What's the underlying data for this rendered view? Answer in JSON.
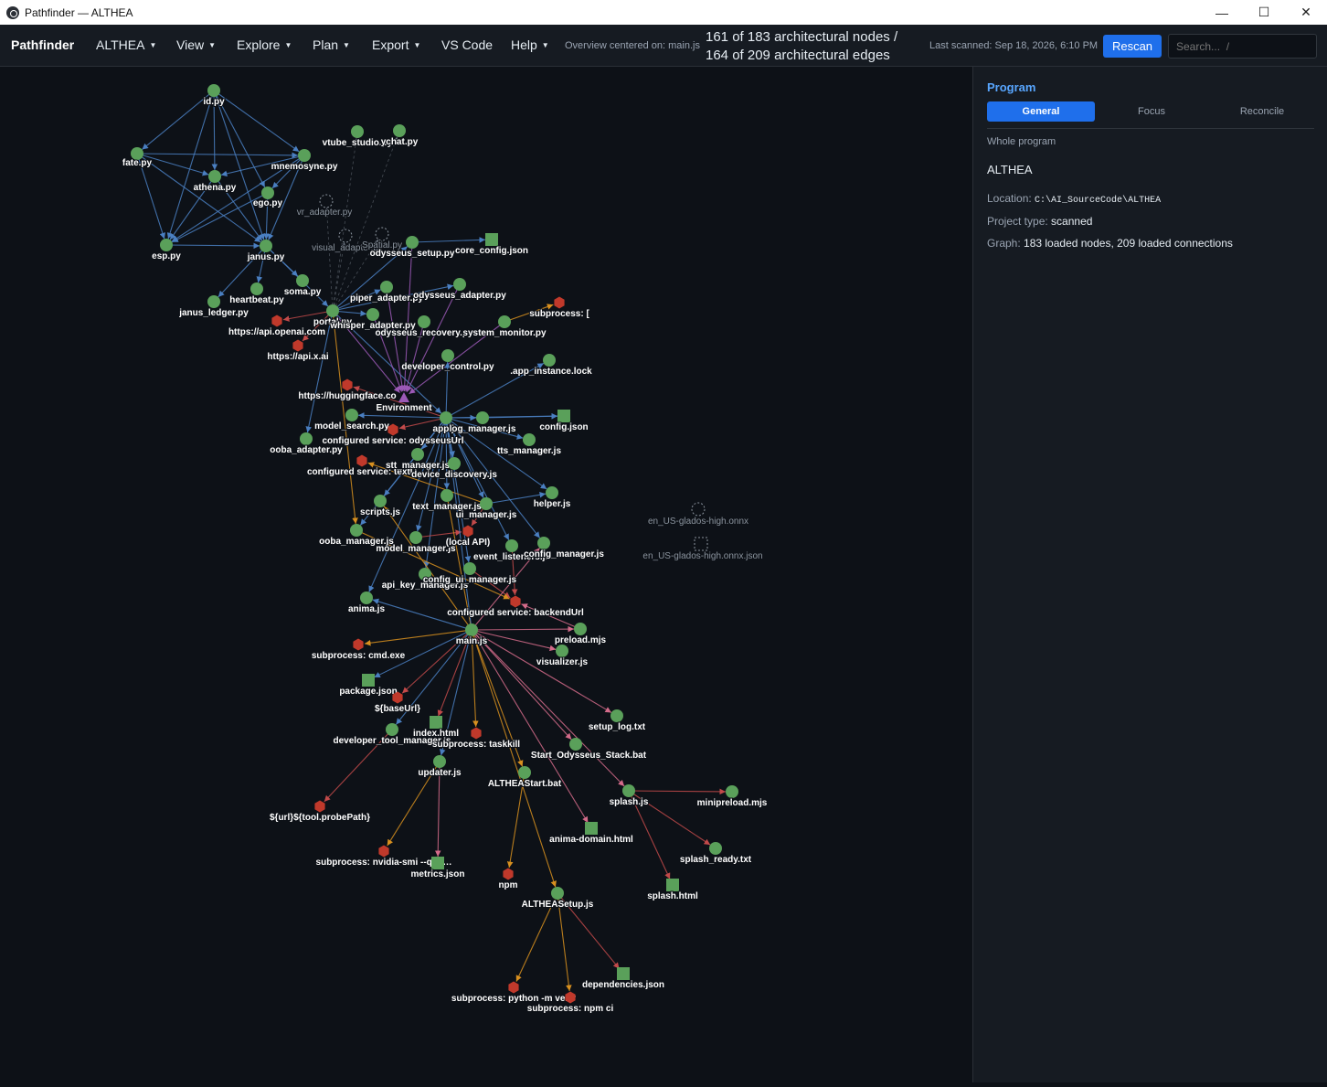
{
  "window": {
    "title": "Pathfinder — ALTHEA",
    "minimize_icon": "minimize-icon",
    "maximize_icon": "maximize-icon",
    "close_icon": "close-icon"
  },
  "menubar": {
    "brand": "Pathfinder",
    "items": [
      "ALTHEA",
      "View",
      "Explore",
      "Plan",
      "Export",
      "VS Code",
      "Help"
    ],
    "overview": "Overview centered on: main.js",
    "counts_line1": "161 of 183 architectural nodes /",
    "counts_line2": "164 of 209 architectural edges",
    "last_scanned": "Last scanned: Sep 18, 2026, 6:10 PM",
    "rescan": "Rescan",
    "search_placeholder": "Search...  /"
  },
  "panel": {
    "title": "Program",
    "tabs": [
      "General",
      "Focus",
      "Reconcile"
    ],
    "active_tab": "General",
    "section": "Whole program",
    "program_name": "ALTHEA",
    "location_label": "Location:",
    "location": "C:\\AI_SourceCode\\ALTHEA",
    "project_type_label": "Project type:",
    "project_type": "scanned",
    "graph_label": "Graph:",
    "graph_summary": "183 loaded nodes, 209 loaded connections"
  },
  "graph": {
    "colors": {
      "background": "#0d1117",
      "file_node": "#5aa05a",
      "config_node": "#5aa05a",
      "external_node": "#c0392b",
      "hub_node": "#9b59b6",
      "edge_blue": "#4a7fc1",
      "edge_orange": "#d8901f",
      "edge_red": "#c24a4a",
      "edge_purple": "#9b59b6",
      "edge_pink": "#d46b8a",
      "edge_dashed": "#6e7681"
    },
    "nodes": [
      {
        "id": "id",
        "label": "id.py",
        "shape": "circle"
      },
      {
        "id": "fate",
        "label": "fate.py",
        "shape": "circle"
      },
      {
        "id": "mnemosyne",
        "label": "mnemosyne.py",
        "shape": "circle"
      },
      {
        "id": "athena",
        "label": "athena.py",
        "shape": "circle"
      },
      {
        "id": "ego",
        "label": "ego.py",
        "shape": "circle"
      },
      {
        "id": "esp",
        "label": "esp.py",
        "shape": "circle"
      },
      {
        "id": "janus",
        "label": "janus.py",
        "shape": "circle"
      },
      {
        "id": "vtube",
        "label": "vtube_studio.py",
        "shape": "circle"
      },
      {
        "id": "ychat",
        "label": "ychat.py",
        "shape": "circle"
      },
      {
        "id": "vr_adapter",
        "label": "vr_adapter.py",
        "shape": "dashed"
      },
      {
        "id": "visual_adapter",
        "label": "visual_adapter.py",
        "shape": "dashed"
      },
      {
        "id": "spatial",
        "label": "Spatial.py",
        "shape": "dashed"
      },
      {
        "id": "odysseus_setup",
        "label": "odysseus_setup.py",
        "shape": "circle"
      },
      {
        "id": "core_config",
        "label": "core_config.json",
        "shape": "square"
      },
      {
        "id": "soma",
        "label": "soma.py",
        "shape": "circle"
      },
      {
        "id": "heartbeat",
        "label": "heartbeat.py",
        "shape": "circle"
      },
      {
        "id": "janus_ledger",
        "label": "janus_ledger.py",
        "shape": "circle"
      },
      {
        "id": "piper",
        "label": "piper_adapter.py",
        "shape": "circle"
      },
      {
        "id": "odysseus_adapter",
        "label": "odysseus_adapter.py",
        "shape": "circle"
      },
      {
        "id": "portal",
        "label": "portal.py",
        "shape": "circle"
      },
      {
        "id": "whisper",
        "label": "whisper_adapter.py",
        "shape": "circle"
      },
      {
        "id": "odysseus_recovery",
        "label": "odysseus_recovery.py",
        "shape": "circle"
      },
      {
        "id": "system_monitor",
        "label": "system_monitor.py",
        "shape": "circle"
      },
      {
        "id": "subprocess_bracket",
        "label": "subprocess: [",
        "shape": "hexagon"
      },
      {
        "id": "openai",
        "label": "https://api.openai.com",
        "shape": "hexagon"
      },
      {
        "id": "xai",
        "label": "https://api.x.ai",
        "shape": "hexagon"
      },
      {
        "id": "developer_control",
        "label": "developer_control.py",
        "shape": "circle"
      },
      {
        "id": "app_instance",
        "label": ".app_instance.lock",
        "shape": "circle"
      },
      {
        "id": "huggingface",
        "label": "https://huggingface.co",
        "shape": "hexagon"
      },
      {
        "id": "environment",
        "label": "Environment",
        "shape": "triangle"
      },
      {
        "id": "model_search",
        "label": "model_search.py",
        "shape": "circle"
      },
      {
        "id": "app_js",
        "label": "app.js",
        "shape": "circle"
      },
      {
        "id": "log_manager",
        "label": "log_manager.js",
        "shape": "circle"
      },
      {
        "id": "config_json",
        "label": "config.json",
        "shape": "square"
      },
      {
        "id": "svc_odysseus",
        "label": "configured service: odysseusUrl",
        "shape": "hexagon"
      },
      {
        "id": "ooba_adapter",
        "label": "ooba_adapter.py",
        "shape": "circle"
      },
      {
        "id": "tts_manager",
        "label": "tts_manager.js",
        "shape": "circle"
      },
      {
        "id": "svc_textu",
        "label": "configured service: textU",
        "shape": "hexagon"
      },
      {
        "id": "stt_manager",
        "label": "stt_manager.js",
        "shape": "circle"
      },
      {
        "id": "device_discovery",
        "label": "device_discovery.js",
        "shape": "circle"
      },
      {
        "id": "scripts_js",
        "label": "scripts.js",
        "shape": "circle"
      },
      {
        "id": "text_manager",
        "label": "text_manager.js",
        "shape": "circle"
      },
      {
        "id": "ui_manager",
        "label": "ui_manager.js",
        "shape": "circle"
      },
      {
        "id": "helper",
        "label": "helper.js",
        "shape": "circle"
      },
      {
        "id": "ooba_manager",
        "label": "ooba_manager.js",
        "shape": "circle"
      },
      {
        "id": "model_manager",
        "label": "model_manager.js",
        "shape": "circle"
      },
      {
        "id": "local_api",
        "label": "(local API)",
        "shape": "hexagon"
      },
      {
        "id": "event_listeners",
        "label": "event_listeners.js",
        "shape": "circle"
      },
      {
        "id": "config_manager",
        "label": "config_manager.js",
        "shape": "circle"
      },
      {
        "id": "api_key_manager",
        "label": "api_key_manager.js",
        "shape": "circle"
      },
      {
        "id": "config_ui_manager",
        "label": "config_ui_manager.js",
        "shape": "circle"
      },
      {
        "id": "anima_js",
        "label": "anima.js",
        "shape": "circle"
      },
      {
        "id": "svc_backend",
        "label": "configured service: backendUrl",
        "shape": "hexagon"
      },
      {
        "id": "main_js",
        "label": "main.js",
        "shape": "circle"
      },
      {
        "id": "preload",
        "label": "preload.mjs",
        "shape": "circle"
      },
      {
        "id": "visualizer",
        "label": "visualizer.js",
        "shape": "circle"
      },
      {
        "id": "sub_cmd",
        "label": "subprocess: cmd.exe",
        "shape": "hexagon"
      },
      {
        "id": "package_json",
        "label": "package.json",
        "shape": "square"
      },
      {
        "id": "base_url",
        "label": "${baseUrl}",
        "shape": "hexagon"
      },
      {
        "id": "setup_log",
        "label": "setup_log.txt",
        "shape": "circle"
      },
      {
        "id": "developer_tool",
        "label": "developer_tool_manager.js",
        "shape": "circle"
      },
      {
        "id": "index_html",
        "label": "index.html",
        "shape": "square"
      },
      {
        "id": "sub_taskkill",
        "label": "subprocess: taskkill",
        "shape": "hexagon"
      },
      {
        "id": "start_odysseus",
        "label": "Start_Odysseus_Stack.bat",
        "shape": "circle"
      },
      {
        "id": "updater",
        "label": "updater.js",
        "shape": "circle"
      },
      {
        "id": "althea_start",
        "label": "ALTHEAStart.bat",
        "shape": "circle"
      },
      {
        "id": "splash_js",
        "label": "splash.js",
        "shape": "circle"
      },
      {
        "id": "minipreload",
        "label": "minipreload.mjs",
        "shape": "circle"
      },
      {
        "id": "url_probe",
        "label": "${url}${tool.probePath}",
        "shape": "hexagon"
      },
      {
        "id": "anima_domain",
        "label": "anima-domain.html",
        "shape": "square"
      },
      {
        "id": "splash_ready",
        "label": "splash_ready.txt",
        "shape": "circle"
      },
      {
        "id": "sub_nvidia",
        "label": "subprocess: nvidia-smi --que…",
        "shape": "hexagon"
      },
      {
        "id": "metrics",
        "label": "metrics.json",
        "shape": "square"
      },
      {
        "id": "npm",
        "label": "npm",
        "shape": "hexagon"
      },
      {
        "id": "splash_html",
        "label": "splash.html",
        "shape": "square"
      },
      {
        "id": "althea_setup",
        "label": "ALTHEASetup.js",
        "shape": "circle"
      },
      {
        "id": "dependencies",
        "label": "dependencies.json",
        "shape": "square"
      },
      {
        "id": "sub_python",
        "label": "subprocess: python -m venv",
        "shape": "hexagon"
      },
      {
        "id": "sub_npmci",
        "label": "subprocess: npm ci",
        "shape": "hexagon"
      },
      {
        "id": "glados_onnx",
        "label": "en_US-glados-high.onnx",
        "shape": "dashed"
      },
      {
        "id": "glados_json",
        "label": "en_US-glados-high.onnx.json",
        "shape": "dashed-square"
      }
    ],
    "edges": [
      [
        "id",
        "fate",
        "blue"
      ],
      [
        "id",
        "mnemosyne",
        "blue"
      ],
      [
        "id",
        "athena",
        "blue"
      ],
      [
        "id",
        "esp",
        "blue"
      ],
      [
        "id",
        "janus",
        "blue"
      ],
      [
        "id",
        "ego",
        "blue"
      ],
      [
        "fate",
        "mnemosyne",
        "blue"
      ],
      [
        "fate",
        "athena",
        "blue"
      ],
      [
        "fate",
        "esp",
        "blue"
      ],
      [
        "fate",
        "janus",
        "blue"
      ],
      [
        "mnemosyne",
        "athena",
        "blue"
      ],
      [
        "mnemosyne",
        "esp",
        "blue"
      ],
      [
        "mnemosyne",
        "janus",
        "blue"
      ],
      [
        "mnemosyne",
        "ego",
        "blue"
      ],
      [
        "athena",
        "esp",
        "blue"
      ],
      [
        "athena",
        "janus",
        "blue"
      ],
      [
        "ego",
        "esp",
        "blue"
      ],
      [
        "ego",
        "janus",
        "blue"
      ],
      [
        "esp",
        "janus",
        "blue"
      ],
      [
        "janus",
        "soma",
        "blue"
      ],
      [
        "janus",
        "portal",
        "blue"
      ],
      [
        "janus",
        "heartbeat",
        "blue"
      ],
      [
        "janus",
        "janus_ledger",
        "blue"
      ],
      [
        "portal",
        "openai",
        "red"
      ],
      [
        "portal",
        "xai",
        "red"
      ],
      [
        "portal",
        "vr_adapter",
        "dashed"
      ],
      [
        "portal",
        "visual_adapter",
        "dashed"
      ],
      [
        "portal",
        "vtube",
        "dashed"
      ],
      [
        "portal",
        "ychat",
        "dashed"
      ],
      [
        "portal",
        "spatial",
        "dashed"
      ],
      [
        "portal",
        "piper",
        "blue"
      ],
      [
        "portal",
        "odysseus_adapter",
        "blue"
      ],
      [
        "portal",
        "whisper",
        "blue"
      ],
      [
        "portal",
        "odysseus_setup",
        "blue"
      ],
      [
        "portal",
        "environment",
        "purple"
      ],
      [
        "portal",
        "app_js",
        "blue"
      ],
      [
        "portal",
        "ooba_adapter",
        "blue"
      ],
      [
        "portal",
        "ooba_manager",
        "orange"
      ],
      [
        "odysseus_setup",
        "core_config",
        "blue"
      ],
      [
        "odysseus_setup",
        "environment",
        "purple"
      ],
      [
        "odysseus_adapter",
        "environment",
        "purple"
      ],
      [
        "odysseus_recovery",
        "environment",
        "purple"
      ],
      [
        "system_monitor",
        "subprocess_bracket",
        "orange"
      ],
      [
        "system_monitor",
        "environment",
        "purple"
      ],
      [
        "piper",
        "environment",
        "purple"
      ],
      [
        "whisper",
        "environment",
        "purple"
      ],
      [
        "app_js",
        "developer_control",
        "blue"
      ],
      [
        "app_js",
        "app_instance",
        "blue"
      ],
      [
        "app_js",
        "config_json",
        "blue"
      ],
      [
        "app_js",
        "log_manager",
        "blue"
      ],
      [
        "app_js",
        "huggingface",
        "red"
      ],
      [
        "app_js",
        "model_search",
        "blue"
      ],
      [
        "app_js",
        "svc_odysseus",
        "red"
      ],
      [
        "app_js",
        "tts_manager",
        "blue"
      ],
      [
        "app_js",
        "stt_manager",
        "blue"
      ],
      [
        "app_js",
        "device_discovery",
        "blue"
      ],
      [
        "app_js",
        "scripts_js",
        "blue"
      ],
      [
        "app_js",
        "text_manager",
        "blue"
      ],
      [
        "app_js",
        "ui_manager",
        "blue"
      ],
      [
        "app_js",
        "ooba_manager",
        "blue"
      ],
      [
        "app_js",
        "model_manager",
        "blue"
      ],
      [
        "app_js",
        "event_listeners",
        "blue"
      ],
      [
        "app_js",
        "config_manager",
        "blue"
      ],
      [
        "app_js",
        "api_key_manager",
        "blue"
      ],
      [
        "app_js",
        "anima_js",
        "blue"
      ],
      [
        "app_js",
        "helper",
        "blue"
      ],
      [
        "app_js",
        "config_ui_manager",
        "blue"
      ],
      [
        "log_manager",
        "config_json",
        "blue"
      ],
      [
        "ui_manager",
        "local_api",
        "red"
      ],
      [
        "ui_manager",
        "svc_textu",
        "orange"
      ],
      [
        "ui_manager",
        "helper",
        "blue"
      ],
      [
        "model_manager",
        "local_api",
        "red"
      ],
      [
        "event_listeners",
        "svc_backend",
        "red"
      ],
      [
        "config_ui_manager",
        "svc_backend",
        "red"
      ],
      [
        "ooba_manager",
        "svc_backend",
        "orange"
      ],
      [
        "main_js",
        "preload",
        "pink"
      ],
      [
        "main_js",
        "visualizer",
        "pink"
      ],
      [
        "main_js",
        "sub_cmd",
        "orange"
      ],
      [
        "main_js",
        "package_json",
        "blue"
      ],
      [
        "main_js",
        "base_url",
        "red"
      ],
      [
        "main_js",
        "setup_log",
        "pink"
      ],
      [
        "main_js",
        "developer_tool",
        "blue"
      ],
      [
        "main_js",
        "index_html",
        "red"
      ],
      [
        "main_js",
        "sub_taskkill",
        "orange"
      ],
      [
        "main_js",
        "start_odysseus",
        "pink"
      ],
      [
        "main_js",
        "updater",
        "blue"
      ],
      [
        "main_js",
        "althea_start",
        "orange"
      ],
      [
        "main_js",
        "splash_js",
        "pink"
      ],
      [
        "main_js",
        "anima_domain",
        "pink"
      ],
      [
        "main_js",
        "althea_setup",
        "orange"
      ],
      [
        "main_js",
        "config_manager",
        "pink"
      ],
      [
        "main_js",
        "text_manager",
        "orange"
      ],
      [
        "main_js",
        "scripts_js",
        "orange"
      ],
      [
        "main_js",
        "anima_js",
        "blue"
      ],
      [
        "main_js",
        "app_js",
        "blue"
      ],
      [
        "splash_js",
        "minipreload",
        "red"
      ],
      [
        "splash_js",
        "splash_ready",
        "red"
      ],
      [
        "splash_js",
        "splash_html",
        "red"
      ],
      [
        "developer_tool",
        "url_probe",
        "red"
      ],
      [
        "updater",
        "sub_nvidia",
        "orange"
      ],
      [
        "updater",
        "metrics",
        "pink"
      ],
      [
        "althea_start",
        "npm",
        "orange"
      ],
      [
        "althea_setup",
        "dependencies",
        "red"
      ],
      [
        "althea_setup",
        "sub_python",
        "orange"
      ],
      [
        "althea_setup",
        "sub_npmci",
        "orange"
      ],
      [
        "preload",
        "svc_backend",
        "pink"
      ]
    ]
  }
}
